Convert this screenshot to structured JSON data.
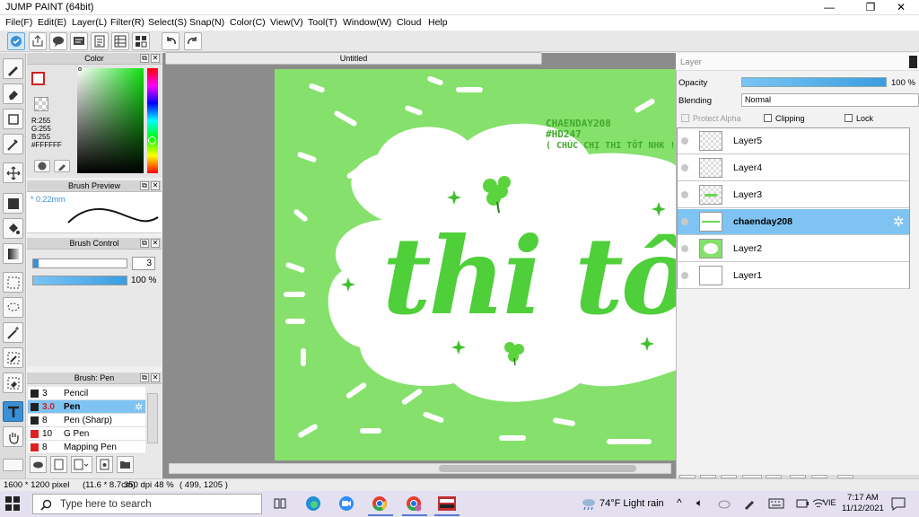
{
  "window": {
    "title": "JUMP PAINT (64bit)",
    "minimize": "—",
    "maximize": "❐",
    "close": "✕"
  },
  "menu": [
    "File(F)",
    "Edit(E)",
    "Layer(L)",
    "Filter(R)",
    "Select(S)",
    "Snap(N)",
    "Color(C)",
    "View(V)",
    "Tool(T)",
    "Window(W)",
    "Cloud",
    "Help"
  ],
  "document": {
    "tab_title": "Untitled"
  },
  "color_panel": {
    "title": "Color",
    "r": "R:255",
    "g": "G:255",
    "b": "B:255",
    "hex": "#FFFFFF"
  },
  "brush_preview": {
    "title": "Brush Preview",
    "size": "* 0.22mm"
  },
  "brush_control": {
    "title": "Brush Control",
    "size_value": "3",
    "opacity_value": "100 %",
    "size_fraction": 0.06,
    "opacity_fraction": 1.0
  },
  "brush_list": {
    "title": "Brush: Pen",
    "items": [
      {
        "size": "3",
        "name": "Pencil",
        "color": "#222222"
      },
      {
        "size": "3.0",
        "name": "Pen",
        "color": "#222222",
        "selected": true
      },
      {
        "size": "8",
        "name": "Pen (Sharp)",
        "color": "#222222"
      },
      {
        "size": "10",
        "name": "G Pen",
        "color": "#e02020"
      },
      {
        "size": "8",
        "name": "Mapping Pen",
        "color": "#e02020"
      }
    ]
  },
  "layer_panel": {
    "title": "Layer",
    "opacity_label": "Opacity",
    "opacity_value": "100 %",
    "blending_label": "Blending",
    "blending_value": "Normal",
    "protect_alpha": "Protect Alpha",
    "clipping": "Clipping",
    "lock": "Lock",
    "layers": [
      {
        "name": "Layer5"
      },
      {
        "name": "Layer4"
      },
      {
        "name": "Layer3"
      },
      {
        "name": "chaenday208",
        "selected": true
      },
      {
        "name": "Layer2"
      },
      {
        "name": "Layer1"
      }
    ]
  },
  "artwork": {
    "watermark_line1": "CHAENDAY208",
    "watermark_line2": "#HD247",
    "watermark_line3": "( CHÚC CHỊ THI TỐT NHK !",
    "lettering": "thi tốt",
    "bg_color": "#86e06c",
    "lettering_color": "#4fcf3a"
  },
  "status": {
    "size": "1600 * 1200 pixel",
    "physical": "(11.6 * 8.7cm)",
    "dpi": "350 dpi",
    "zoom": "48 %",
    "coords": "( 499, 1205 )"
  },
  "taskbar": {
    "search_placeholder": "Type here to search",
    "weather": "74°F  Light rain",
    "lang": "VIE",
    "time": "7:17 AM",
    "date": "11/12/2021"
  },
  "colors": {
    "accent": "#3b8fd6",
    "selection": "#7fc3f2"
  }
}
